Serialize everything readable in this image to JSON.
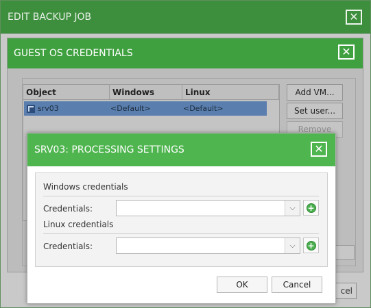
{
  "edit_backup_job": {
    "title": "EDIT BACKUP JOB",
    "close_glyph": "✕",
    "cancel_partial": "cel"
  },
  "guest_os_credentials": {
    "title": "GUEST OS CREDENTIALS",
    "close_glyph": "✕",
    "table": {
      "columns": [
        "Object",
        "Windows",
        "Linux"
      ],
      "rows": [
        {
          "object": "srv03",
          "windows": "<Default>",
          "linux": "<Default>",
          "icon": "vm-icon",
          "selected": true
        }
      ]
    },
    "buttons": {
      "add_vm": "Add VM...",
      "set_user": "Set user...",
      "remove": "Remove"
    }
  },
  "processing_settings": {
    "title": "SRV03: PROCESSING SETTINGS",
    "close_glyph": "✕",
    "windows_section": "Windows credentials",
    "linux_section": "Linux credentials",
    "windows_credentials_label": "Credentials:",
    "linux_credentials_label": "Credentials:",
    "windows_credentials_value": "",
    "linux_credentials_value": "",
    "ok": "OK",
    "cancel": "Cancel"
  },
  "colors": {
    "header_green_active": "#4fb54f",
    "header_green_dim": "#3d8f3d",
    "selected_row": "#5a7fae",
    "add_icon_green": "#4caf50"
  }
}
